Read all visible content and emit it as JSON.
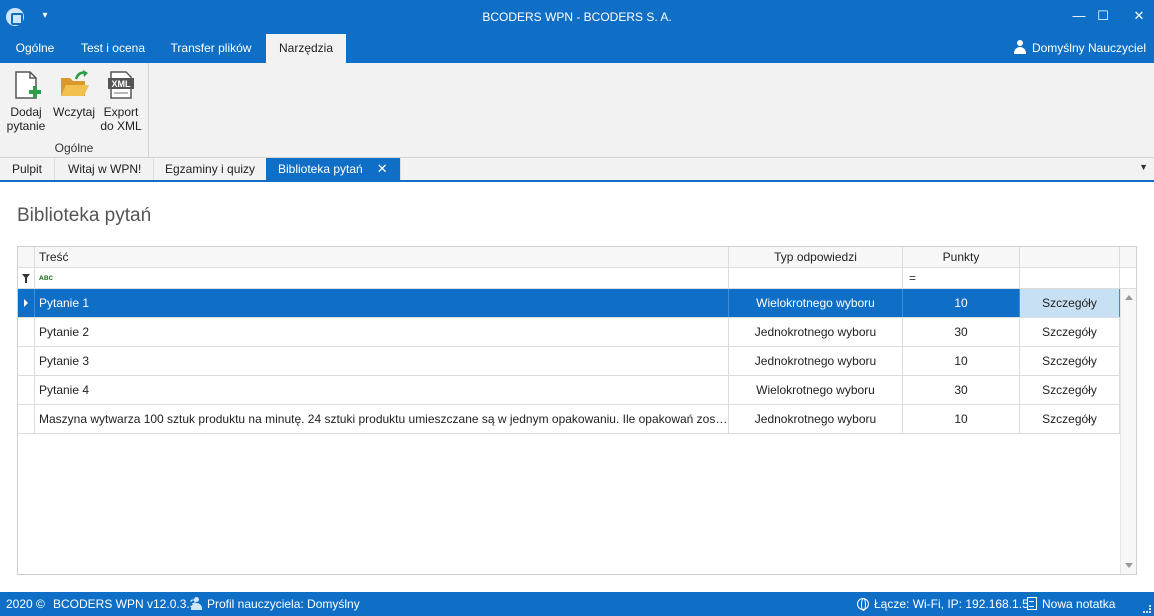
{
  "window": {
    "title": "BCODERS WPN - BCODERS S. A.",
    "min_glyph": "—",
    "max_glyph": "☐",
    "close_glyph": "✕",
    "qa_glyph": "▾"
  },
  "ribbon_tabs": [
    {
      "label": "Ogólne"
    },
    {
      "label": "Test i ocena"
    },
    {
      "label": "Transfer plików"
    },
    {
      "label": "Narzędzia",
      "active": true
    }
  ],
  "user": {
    "name": "Domyślny Nauczyciel"
  },
  "ribbon": {
    "buttons": [
      {
        "line1": "Dodaj",
        "line2": "pytanie",
        "icon": "add-document-icon"
      },
      {
        "line1": "Wczytaj",
        "line2": "",
        "icon": "open-folder-icon"
      },
      {
        "line1": "Export",
        "line2": "do XML",
        "icon": "xml-file-icon"
      }
    ],
    "xml_icon_text": "XML",
    "group_label": "Ogólne"
  },
  "doc_tabs": [
    {
      "label": "Pulpit"
    },
    {
      "label": "Witaj w WPN!"
    },
    {
      "label": "Egzaminy i quizy"
    },
    {
      "label": "Biblioteka pytań",
      "active": true,
      "close": "✕"
    }
  ],
  "tabs_dropdown_glyph": "▼",
  "page": {
    "heading": "Biblioteka pytań"
  },
  "grid": {
    "columns": {
      "tresc": "Treść",
      "typ": "Typ odpowiedzi",
      "punkty": "Punkty",
      "details": ""
    },
    "filter": {
      "text_icon": "ᴀʙc",
      "num_icon": "="
    },
    "rows": [
      {
        "tresc": "Pytanie 1",
        "typ": "Wielokrotnego wyboru",
        "punkty": "10",
        "details": "Szczegóły",
        "selected": true
      },
      {
        "tresc": "Pytanie 2",
        "typ": "Jednokrotnego wyboru",
        "punkty": "30",
        "details": "Szczegóły"
      },
      {
        "tresc": "Pytanie 3",
        "typ": "Jednokrotnego wyboru",
        "punkty": "10",
        "details": "Szczegóły"
      },
      {
        "tresc": "Pytanie 4",
        "typ": "Wielokrotnego wyboru",
        "punkty": "30",
        "details": "Szczegóły"
      },
      {
        "tresc": "Maszyna wytwarza 100 sztuk produktu na minutę. 24 sztuki produktu umieszczane są w jednym opakowaniu. Ile opakowań zost...",
        "typ": "Jednokrotnego wyboru",
        "punkty": "10",
        "details": "Szczegóły"
      }
    ]
  },
  "status": {
    "copyright": "2020 ©",
    "version": "BCODERS WPN v12.0.3.3",
    "profile": "Profil nauczyciela: Domyślny",
    "connection": "Łącze: Wi-Fi, IP: 192.168.1.5",
    "new_note": "Nowa notatka"
  },
  "colors": {
    "accent": "#0f6fc6",
    "selected_detail": "#c7e0f4"
  }
}
